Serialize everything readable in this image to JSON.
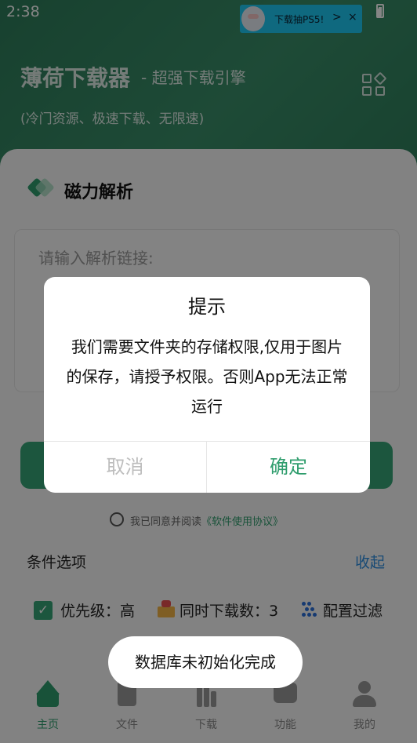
{
  "status_bar": {
    "time": "2:38"
  },
  "ad_banner": {
    "text": "下载抽PS5!",
    "arrow": ">",
    "close": "×"
  },
  "header": {
    "title": "薄荷下载器",
    "subtitle": "- 超强下载引擎",
    "note": "(冷门资源、极速下载、无限速)",
    "grid_icon": "grid-icon"
  },
  "main": {
    "section_title": "磁力解析",
    "input_placeholder": "请输入解析链接:",
    "agree_prefix": "我已同意并阅读",
    "agree_link": "《软件使用协议》",
    "conditions_label": "条件选项",
    "collapse_label": "收起",
    "options": [
      {
        "label": "优先级：高",
        "icon": "checkbox-checked"
      },
      {
        "label": "同时下载数：3",
        "icon": "gift-icon"
      },
      {
        "label": "配置过滤",
        "icon": "filter-icon"
      }
    ]
  },
  "dialog": {
    "title": "提示",
    "message": "我们需要文件夹的存储权限,仅用于图片的保存，请授予权限。否则App无法正常运行",
    "cancel": "取消",
    "confirm": "确定"
  },
  "toast": "数据库未初始化完成",
  "tabbar": [
    {
      "label": "主页",
      "icon": "home-icon",
      "active": true
    },
    {
      "label": "文件",
      "icon": "file-icon",
      "active": false
    },
    {
      "label": "下载",
      "icon": "download-icon",
      "active": false
    },
    {
      "label": "功能",
      "icon": "function-icon",
      "active": false
    },
    {
      "label": "我的",
      "icon": "user-icon",
      "active": false
    }
  ],
  "colors": {
    "brand_green": "#2f9d6d",
    "header_green": "#2e7d5b",
    "link_blue": "#2e8fe0",
    "ad_cyan": "#1ec9f3"
  }
}
